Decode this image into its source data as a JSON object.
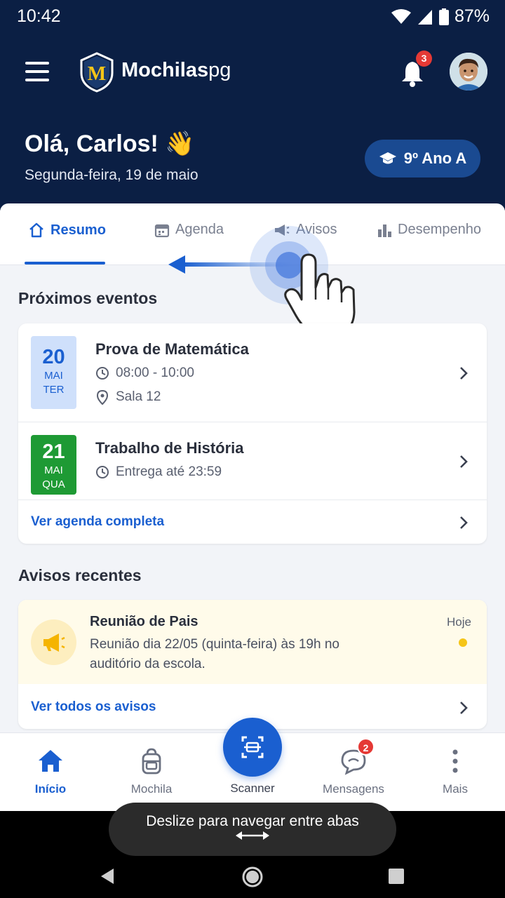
{
  "status": {
    "time": "10:42",
    "battery": "87%"
  },
  "app": {
    "brand_bold": "Mochilas",
    "brand_light": "pg",
    "notifications_count": "3"
  },
  "greeting": {
    "hello": "Olá, Carlos! 👋",
    "date": "Segunda-feira, 19 de maio",
    "class_label": "9º Ano A"
  },
  "tabs": [
    {
      "label": "Resumo",
      "icon": "home-icon",
      "active": true
    },
    {
      "label": "Agenda",
      "icon": "calendar-icon"
    },
    {
      "label": "Avisos",
      "icon": "megaphone-icon"
    },
    {
      "label": "Desempenho",
      "icon": "bar-chart-icon"
    }
  ],
  "events": {
    "title": "Próximos eventos",
    "items": [
      {
        "day": "20",
        "month": "MAI",
        "weekday": "TER",
        "title": "Prova de Matemática",
        "time": "08:00 - 10:00",
        "place": "Sala 12",
        "color": "#cfe0fb"
      },
      {
        "day": "21",
        "month": "MAI",
        "weekday": "QUA",
        "title": "Trabalho de História",
        "deadline": "Entrega até 23:59",
        "color": "#1e9a34"
      }
    ],
    "link": "Ver agenda completa"
  },
  "notices": {
    "title": "Avisos recentes",
    "items": [
      {
        "title": "Reunião de Pais",
        "body": "Reunião dia 22/05 (quinta-feira) às 19h no auditório da escola.",
        "when": "Hoje"
      }
    ],
    "link": "Ver todos os avisos"
  },
  "bottom_nav": {
    "items": [
      {
        "label": "Início",
        "icon": "home-icon",
        "active": true
      },
      {
        "label": "Mochila",
        "icon": "backpack-icon"
      },
      {
        "label": "Scanner",
        "icon": "scanner-icon"
      },
      {
        "label": "Mensagens",
        "icon": "chat-icon",
        "badge": "2"
      },
      {
        "label": "Mais",
        "icon": "more-vertical-icon"
      }
    ]
  },
  "toast": {
    "text": "Deslize para navegar entre abas",
    "icon": "swap-arrows-icon"
  },
  "colors": {
    "header_bg": "#0b1f44",
    "accent": "#1a5fd0",
    "badge_red": "#e53935"
  }
}
